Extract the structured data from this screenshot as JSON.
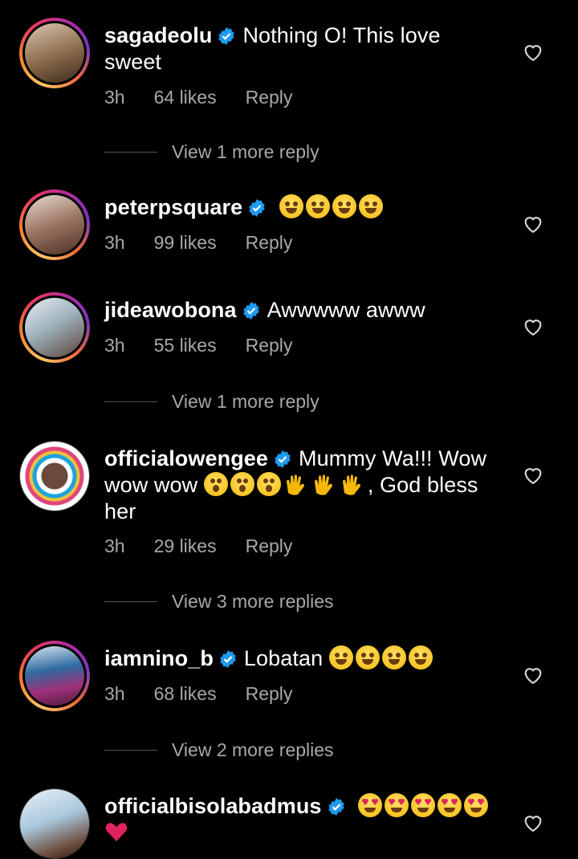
{
  "comments": [
    {
      "username": "sagadeolu",
      "text": "Nothing O! This love",
      "text2": "sweet",
      "time": "3h",
      "likes": "64 likes",
      "reply": "Reply",
      "view_more": "View 1 more reply",
      "avatar_colors": [
        "#8a6a4a",
        "#c9a27c"
      ]
    },
    {
      "username": "peterpsquare",
      "text": "",
      "emoji": [
        "laugh",
        "laugh",
        "laugh",
        "laugh"
      ],
      "time": "3h",
      "likes": "99 likes",
      "reply": "Reply",
      "avatar_colors": [
        "#6a4b3a",
        "#b89a86"
      ]
    },
    {
      "username": "jideawobona",
      "text": "Awwwww awww",
      "time": "3h",
      "likes": "55 likes",
      "reply": "Reply",
      "view_more": "View 1 more reply",
      "avatar_colors": [
        "#7a8f99",
        "#d8e1e6"
      ]
    },
    {
      "username": "officialowengee",
      "text": "Mummy Wa!!! Wow",
      "text2_prefix": "wow wow",
      "text2_suffix": ", God bless",
      "text3": "her",
      "time": "3h",
      "likes": "29 likes",
      "reply": "Reply",
      "view_more": "View 3 more replies",
      "avatar_colors": [
        "#ffffff",
        "#1aa3e0"
      ]
    },
    {
      "username": "iamnino_b",
      "text": "Lobatan",
      "time": "3h",
      "likes": "68 likes",
      "reply": "Reply",
      "view_more": "View 2 more replies",
      "avatar_colors": [
        "#2f6aa0",
        "#a02f7a"
      ]
    },
    {
      "username": "officialbisolabadmus",
      "text": "",
      "avatar_colors": [
        "#c7dbe8",
        "#7fa6c4"
      ]
    }
  ],
  "colors": {
    "verified": "#1d9bf0",
    "muted": "#a8a8a8"
  }
}
